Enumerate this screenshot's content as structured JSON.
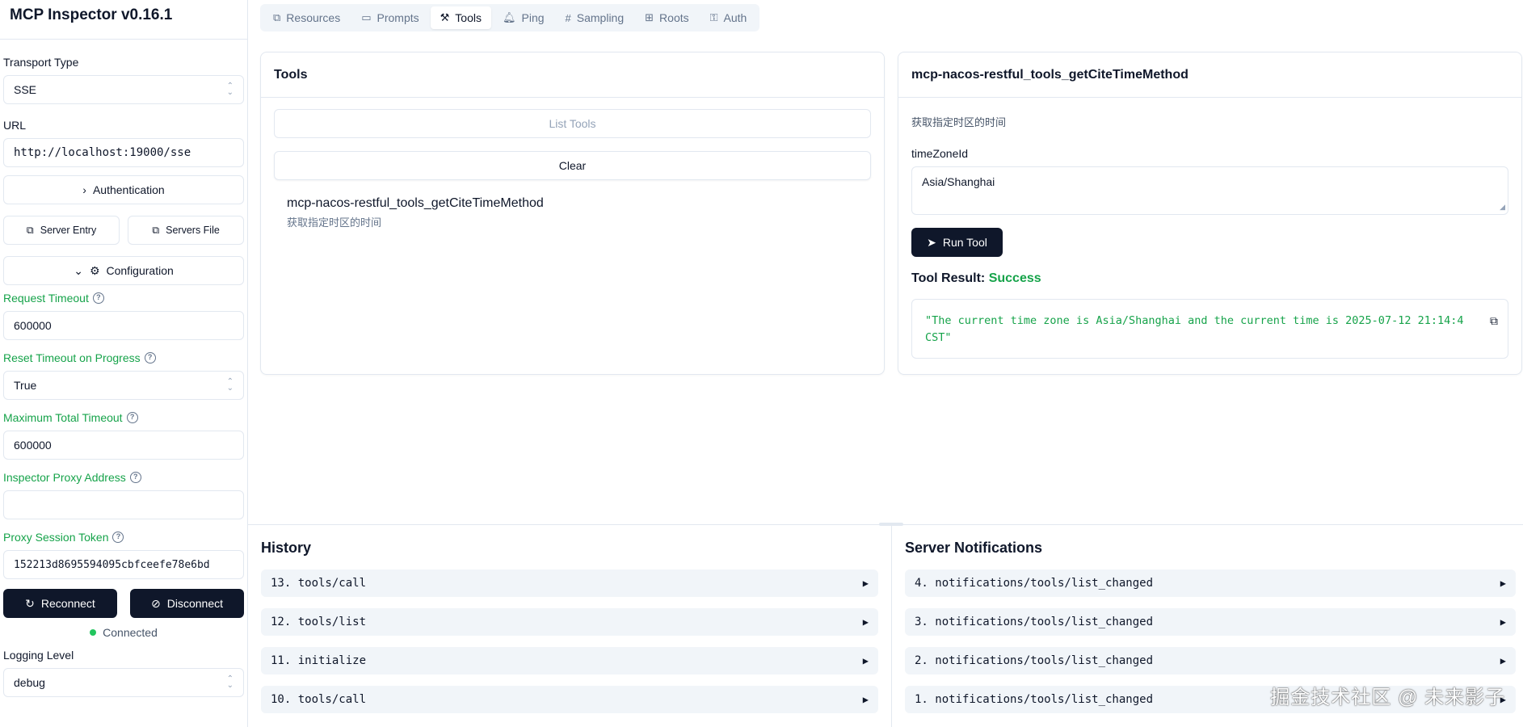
{
  "app": {
    "title": "MCP Inspector v0.16.1"
  },
  "sidebar": {
    "transport_label": "Transport Type",
    "transport_value": "SSE",
    "url_label": "URL",
    "url_value": "http://localhost:19000/sse",
    "authentication": "Authentication",
    "server_entry": "Server Entry",
    "servers_file": "Servers File",
    "configuration": "Configuration",
    "request_timeout_label": "Request Timeout",
    "request_timeout_value": "600000",
    "reset_timeout_label": "Reset Timeout on Progress",
    "reset_timeout_value": "True",
    "max_timeout_label": "Maximum Total Timeout",
    "max_timeout_value": "600000",
    "proxy_address_label": "Inspector Proxy Address",
    "proxy_address_value": "",
    "proxy_token_label": "Proxy Session Token",
    "proxy_token_value": "152213d8695594095cbfceefe78e6bd",
    "reconnect": "Reconnect",
    "disconnect": "Disconnect",
    "status": "Connected",
    "logging_label": "Logging Level",
    "logging_value": "debug"
  },
  "tabs": [
    {
      "label": "Resources",
      "icon": "resources-icon"
    },
    {
      "label": "Prompts",
      "icon": "prompts-icon"
    },
    {
      "label": "Tools",
      "icon": "tools-icon",
      "active": true
    },
    {
      "label": "Ping",
      "icon": "bell-icon"
    },
    {
      "label": "Sampling",
      "icon": "hash-icon"
    },
    {
      "label": "Roots",
      "icon": "tree-icon"
    },
    {
      "label": "Auth",
      "icon": "key-icon"
    }
  ],
  "tools_card": {
    "title": "Tools",
    "list_tools": "List Tools",
    "clear": "Clear",
    "tool_name": "mcp-nacos-restful_tools_getCiteTimeMethod",
    "tool_desc": "获取指定时区的时间"
  },
  "detail_card": {
    "title": "mcp-nacos-restful_tools_getCiteTimeMethod",
    "desc": "获取指定时区的时间",
    "param_label": "timeZoneId",
    "param_value": "Asia/Shanghai",
    "run_tool": "Run Tool",
    "result_label": "Tool Result: ",
    "result_status": "Success",
    "result_line1": "\"The current time zone is Asia/Shanghai and the current time is 2025-07-12 21:14:4",
    "result_line2": "CST\""
  },
  "history": {
    "title": "History",
    "entries": [
      "13. tools/call",
      "12. tools/list",
      "11. initialize",
      "10. tools/call"
    ]
  },
  "notifications": {
    "title": "Server Notifications",
    "entries": [
      "4. notifications/tools/list_changed",
      "3. notifications/tools/list_changed",
      "2. notifications/tools/list_changed",
      "1. notifications/tools/list_changed"
    ]
  },
  "watermark": "掘金技术社区 @ 未来影子"
}
